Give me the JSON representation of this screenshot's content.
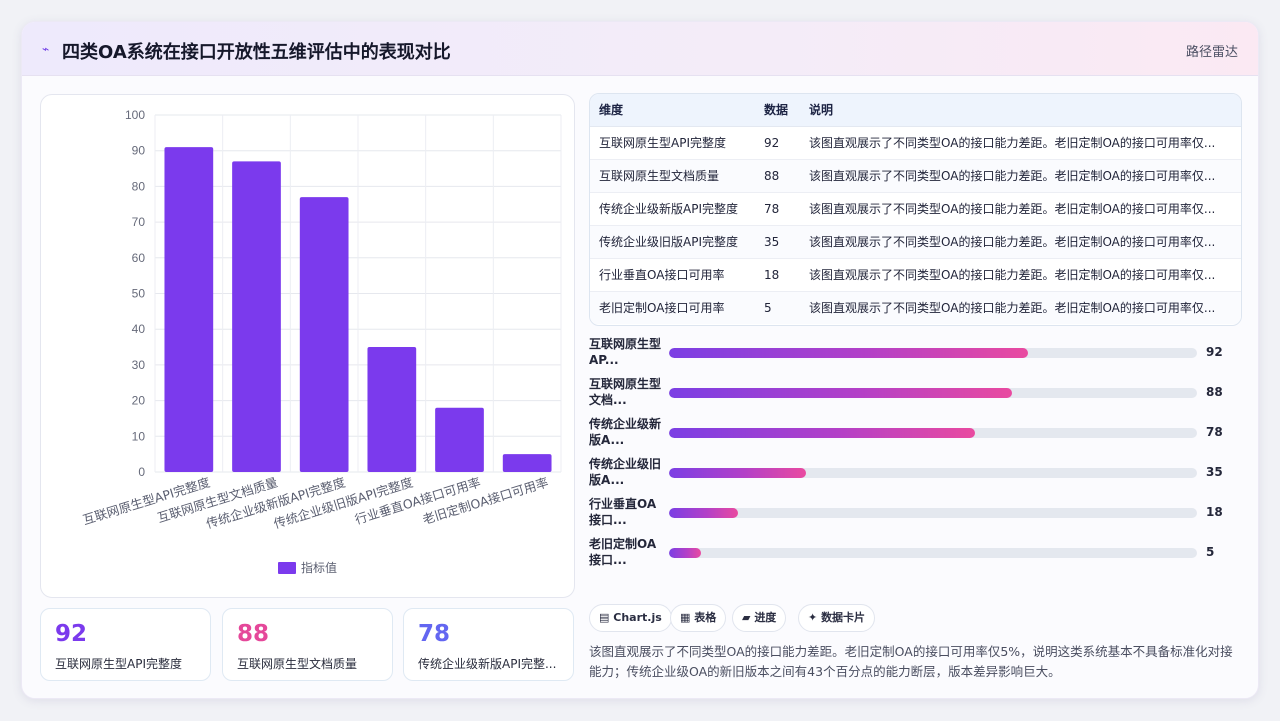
{
  "header": {
    "icon": "trend-icon",
    "title": "四类OA系统在接口开放性五维评估中的表现对比",
    "right_label": "路径雷达"
  },
  "colors": {
    "accent": "#7b3aed",
    "pink": "#e5489a",
    "indigo": "#6366f1"
  },
  "chart_data": {
    "type": "bar",
    "categories": [
      "互联网原生型API完整度",
      "互联网原生型文档质量",
      "传统企业级新版API完整度",
      "传统企业级旧版API完整度",
      "行业垂直OA接口可用率",
      "老旧定制OA接口可用率"
    ],
    "series": [
      {
        "name": "指标值",
        "values": [
          91,
          87,
          77,
          35,
          18,
          5
        ],
        "color": "#7b3aed"
      }
    ],
    "ylim": [
      0,
      100
    ],
    "yticks": [
      "0",
      "10",
      "20",
      "30",
      "40",
      "50",
      "60",
      "70",
      "80",
      "90",
      "100"
    ],
    "grid": true,
    "legend": "bottom"
  },
  "kpis": [
    {
      "value": "92",
      "label": "互联网原生型API完整度",
      "color": "#7b3aed"
    },
    {
      "value": "88",
      "label": "互联网原生型文档质量",
      "color": "#e5489a"
    },
    {
      "value": "78",
      "label": "传统企业级新版API完整...",
      "color": "#6366f1"
    }
  ],
  "table": {
    "headers": [
      "维度",
      "数据",
      "说明"
    ],
    "rows": [
      [
        "互联网原生型API完整度",
        "92",
        "该图直观展示了不同类型OA的接口能力差距。老旧定制OA的接口可用率仅..."
      ],
      [
        "互联网原生型文档质量",
        "88",
        "该图直观展示了不同类型OA的接口能力差距。老旧定制OA的接口可用率仅..."
      ],
      [
        "传统企业级新版API完整度",
        "78",
        "该图直观展示了不同类型OA的接口能力差距。老旧定制OA的接口可用率仅..."
      ],
      [
        "传统企业级旧版API完整度",
        "35",
        "该图直观展示了不同类型OA的接口能力差距。老旧定制OA的接口可用率仅..."
      ],
      [
        "行业垂直OA接口可用率",
        "18",
        "该图直观展示了不同类型OA的接口能力差距。老旧定制OA的接口可用率仅..."
      ],
      [
        "老旧定制OA接口可用率",
        "5",
        "该图直观展示了不同类型OA的接口能力差距。老旧定制OA的接口可用率仅..."
      ]
    ]
  },
  "progress": [
    {
      "label1": "互联网原生型",
      "label2": "AP...",
      "value": "92",
      "fill_pct": 68
    },
    {
      "label1": "互联网原生型",
      "label2": "文档...",
      "value": "88",
      "fill_pct": 65
    },
    {
      "label1": "传统企业级新",
      "label2": "版A...",
      "value": "78",
      "fill_pct": 58
    },
    {
      "label1": "传统企业级旧",
      "label2": "版A...",
      "value": "35",
      "fill_pct": 26
    },
    {
      "label1": "行业垂直OA",
      "label2": "接口...",
      "value": "18",
      "fill_pct": 13
    },
    {
      "label1": "老旧定制OA",
      "label2": "接口...",
      "value": "5",
      "fill_pct": 6
    }
  ],
  "chips": [
    {
      "icon": "chart-icon",
      "glyph": "▤",
      "label": "Chart.js"
    },
    {
      "icon": "table-icon",
      "glyph": "▦",
      "label": "表格"
    },
    {
      "icon": "progress-icon",
      "glyph": "▰",
      "label": "进度"
    },
    {
      "icon": "card-icon",
      "glyph": "✦",
      "label": "数据卡片"
    }
  ],
  "summary": "该图直观展示了不同类型OA的接口能力差距。老旧定制OA的接口可用率仅5%，说明这类系统基本不具备标准化对接能力；传统企业级OA的新旧版本之间有43个百分点的能力断层，版本差异影响巨大。"
}
